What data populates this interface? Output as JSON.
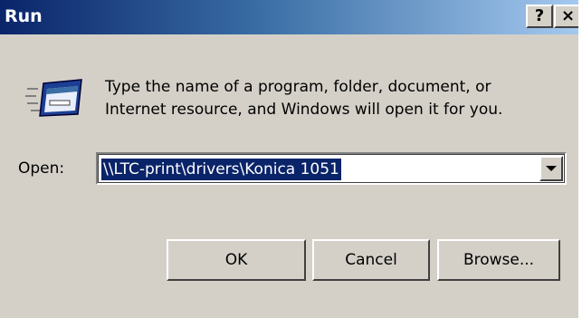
{
  "window": {
    "title": "Run",
    "help_label": "?",
    "close_label": "×"
  },
  "content": {
    "icon": "run-icon",
    "description_line1": "Type the name of a program, folder, document, or",
    "description_line2": "Internet resource, and Windows will open it for you.",
    "open_label": "Open:",
    "open_value": "\\\\LTC-print\\drivers\\Konica 1051"
  },
  "buttons": {
    "ok": "OK",
    "cancel": "Cancel",
    "browse": "Browse..."
  },
  "colors": {
    "title_active": "#0a246a",
    "title_gradient_end": "#a6caf0",
    "face": "#d4d0c8",
    "selection": "#0a246a"
  }
}
